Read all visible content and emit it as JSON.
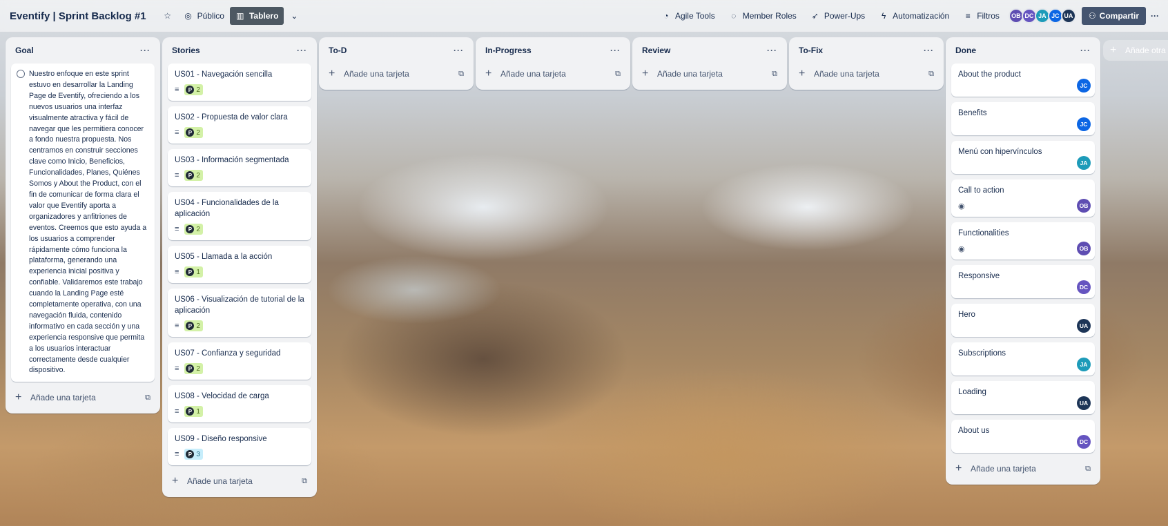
{
  "topbar": {
    "title": "Eventify | Sprint Backlog #1",
    "visibility": "Público",
    "view": "Tablero",
    "agile_tools": "Agile Tools",
    "member_roles": "Member Roles",
    "power_ups": "Power-Ups",
    "automation": "Automatización",
    "filters": "Filtros",
    "share": "Compartir",
    "members": [
      {
        "initials": "OB",
        "color": "#5e4db2"
      },
      {
        "initials": "DC",
        "color": "#6554c0"
      },
      {
        "initials": "JA",
        "color": "#1d9bb9"
      },
      {
        "initials": "JC",
        "color": "#0c66e4"
      },
      {
        "initials": "UA",
        "color": "#1d3557"
      }
    ]
  },
  "lists": {
    "goal": {
      "title": "Goal",
      "text": "Nuestro enfoque en este sprint estuvo en desarrollar la Landing Page de Eventify, ofreciendo a los nuevos usuarios una interfaz visualmente atractiva y fácil de navegar que les permitiera conocer a fondo nuestra propuesta. Nos centramos en construir secciones clave como Inicio, Beneficios, Funcionalidades, Planes, Quiénes Somos y About the Product, con el fin de comunicar de forma clara el valor que Eventify aporta a organizadores y anfitriones de eventos. Creemos que esto ayuda a los usuarios a comprender rápidamente cómo funciona la plataforma, generando una experiencia inicial positiva y confiable. Validaremos este trabajo cuando la Landing Page esté completamente operativa, con una navegación fluida, contenido informativo en cada sección y una experiencia responsive que permita a los usuarios interactuar correctamente desde cualquier dispositivo.",
      "add": "Añade una tarjeta"
    },
    "stories": {
      "title": "Stories",
      "add": "Añade una tarjeta",
      "cards": [
        {
          "title": "US01 - Navegación sencilla",
          "points": "2"
        },
        {
          "title": "US02 - Propuesta de valor clara",
          "points": "2"
        },
        {
          "title": "US03 - Información segmentada",
          "points": "2"
        },
        {
          "title": "US04 - Funcionalidades de la aplicación",
          "points": "2"
        },
        {
          "title": "US05 - Llamada a la acción",
          "points": "1"
        },
        {
          "title": "US06 - Visualización de tutorial de la aplicación",
          "points": "2"
        },
        {
          "title": "US07 - Confianza y seguridad",
          "points": "2"
        },
        {
          "title": "US08 - Velocidad de carga",
          "points": "1"
        },
        {
          "title": "US09 - Diseño responsive",
          "points": "3"
        }
      ]
    },
    "todo": {
      "title": "To-D",
      "add": "Añade una tarjeta"
    },
    "in_progress": {
      "title": "In-Progress",
      "add": "Añade una tarjeta"
    },
    "review": {
      "title": "Review",
      "add": "Añade una tarjeta"
    },
    "to_fix": {
      "title": "To-Fix",
      "add": "Añade una tarjeta"
    },
    "done": {
      "title": "Done",
      "add": "Añade una tarjeta",
      "cards": [
        {
          "title": "About the product",
          "member": "JC",
          "color": "#0c66e4"
        },
        {
          "title": "Benefits",
          "member": "JC",
          "color": "#0c66e4"
        },
        {
          "title": "Menú con hipervínculos",
          "member": "JA",
          "color": "#1d9bb9"
        },
        {
          "title": "Call to action",
          "member": "OB",
          "color": "#5e4db2"
        },
        {
          "title": "Functionalities",
          "member": "OB",
          "color": "#5e4db2"
        },
        {
          "title": "Responsive",
          "member": "DC",
          "color": "#6554c0"
        },
        {
          "title": "Hero",
          "member": "UA",
          "color": "#1d3557"
        },
        {
          "title": "Subscriptions",
          "member": "JA",
          "color": "#1d9bb9"
        },
        {
          "title": "Loading",
          "member": "UA",
          "color": "#1d3557"
        },
        {
          "title": "About us",
          "member": "DC",
          "color": "#6554c0"
        }
      ]
    }
  },
  "add_list": "Añade otra li",
  "icons": {
    "star": "star-icon",
    "globe": "globe-icon",
    "board": "board-icon",
    "chevron": "chevron-down-icon",
    "more": "more-icon",
    "plus": "plus-icon",
    "template": "template-icon",
    "description": "description-icon",
    "eye": "eye-icon"
  }
}
